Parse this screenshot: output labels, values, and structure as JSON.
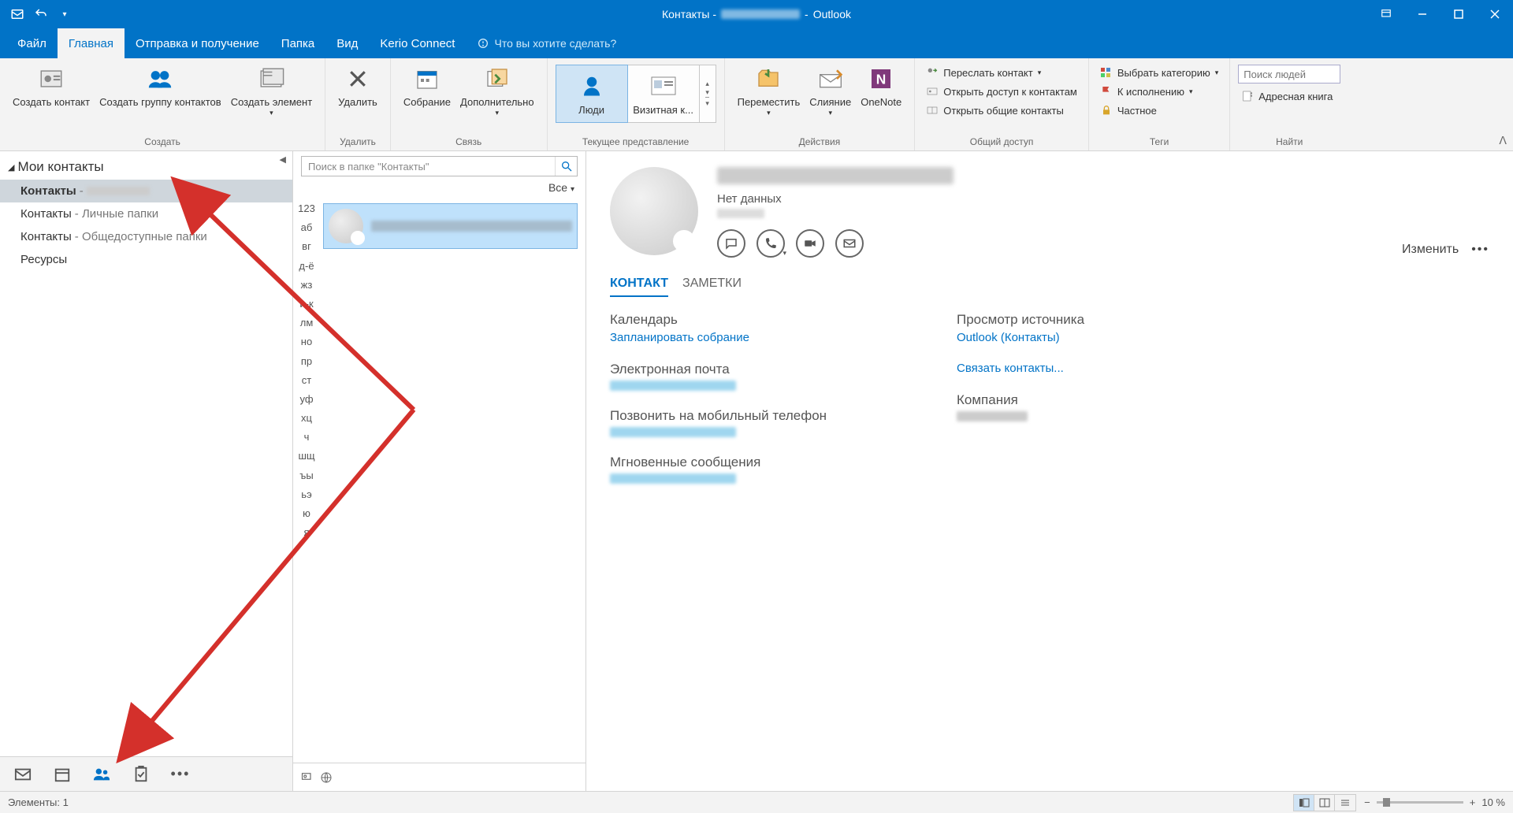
{
  "titlebar": {
    "prefix": "Контакты - ",
    "app": "Outlook"
  },
  "tabs": {
    "file": "Файл",
    "home": "Главная",
    "sendreceive": "Отправка и получение",
    "folder": "Папка",
    "view": "Вид",
    "kerio": "Kerio Connect",
    "tellme": "Что вы хотите сделать?"
  },
  "ribbon": {
    "create": {
      "label": "Создать",
      "contact": "Создать контакт",
      "group": "Создать группу контактов",
      "element": "Создать элемент"
    },
    "delete": {
      "label": "Удалить",
      "btn": "Удалить"
    },
    "comm": {
      "label": "Связь",
      "meeting": "Собрание",
      "more": "Дополнительно"
    },
    "view": {
      "label": "Текущее представление",
      "people": "Люди",
      "card": "Визитная к..."
    },
    "actions": {
      "label": "Действия",
      "move": "Переместить",
      "merge": "Слияние",
      "onenote": "OneNote"
    },
    "share": {
      "label": "Общий доступ",
      "forward": "Переслать контакт",
      "open_access": "Открыть доступ к контактам",
      "open_shared": "Открыть общие контакты"
    },
    "tags": {
      "label": "Теги",
      "category": "Выбрать категорию",
      "followup": "К исполнению",
      "private": "Частное"
    },
    "find": {
      "label": "Найти",
      "search_ph": "Поиск людей",
      "addressbook": "Адресная книга"
    }
  },
  "sidebar": {
    "header": "Мои контакты",
    "items": [
      {
        "name": "Контакты",
        "suffix": " - ",
        "blurred": true,
        "selected": true
      },
      {
        "name": "Контакты",
        "suffix": " - Личные папки"
      },
      {
        "name": "Контакты",
        "suffix": " - Общедоступные папки"
      },
      {
        "name": "Ресурсы",
        "suffix": ""
      }
    ]
  },
  "list": {
    "search_ph": "Поиск в папке \"Контакты\"",
    "filter": "Все",
    "alpha": [
      "123",
      "аб",
      "вг",
      "д-ё",
      "жз",
      "и-к",
      "лм",
      "но",
      "пр",
      "ст",
      "уф",
      "хц",
      "ч",
      "шщ",
      "ъы",
      "ьэ",
      "ю",
      "я"
    ]
  },
  "details": {
    "nodata": "Нет данных",
    "edit": "Изменить",
    "tabs": {
      "contact": "КОНТАКТ",
      "notes": "ЗАМЕТКИ"
    },
    "left": {
      "calendar": "Календарь",
      "schedule": "Запланировать собрание",
      "email": "Электронная почта",
      "call": "Позвонить на мобильный телефон",
      "im": "Мгновенные сообщения"
    },
    "right": {
      "source_h": "Просмотр источника",
      "source_link": "Outlook (Контакты)",
      "link_contacts": "Связать контакты...",
      "company": "Компания"
    }
  },
  "statusbar": {
    "elements": "Элементы: 1",
    "zoom": "10 %"
  }
}
